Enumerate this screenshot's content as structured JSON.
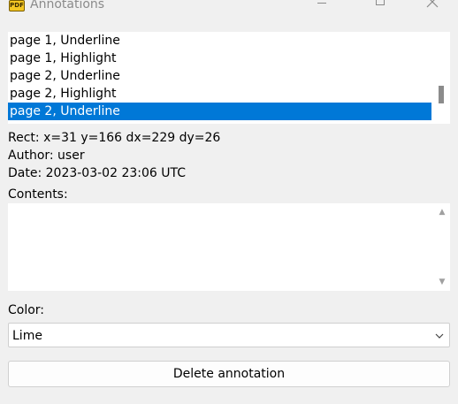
{
  "window": {
    "title": "Annotations",
    "icon": "pdf-app-icon",
    "icon_text": "PDF",
    "controls": {
      "minimize_icon": "minimize-icon",
      "maximize_icon": "maximize-icon",
      "close_icon": "close-icon"
    }
  },
  "annotations_list": {
    "items": [
      {
        "label": "page 1, Underline"
      },
      {
        "label": "page 1, Highlight"
      },
      {
        "label": "page 2, Underline"
      },
      {
        "label": "page 2, Highlight"
      },
      {
        "label": "page 2, Underline",
        "selected": true
      }
    ],
    "selected_color": "#0078d7"
  },
  "details": {
    "rect": "Rect: x=31 y=166 dx=229 dy=26",
    "author": "Author: user",
    "date": "Date: 2023-03-02 23:06 UTC"
  },
  "contents": {
    "label": "Contents:",
    "value": ""
  },
  "color": {
    "label": "Color:",
    "selected": "Lime"
  },
  "actions": {
    "delete_label": "Delete annotation"
  }
}
